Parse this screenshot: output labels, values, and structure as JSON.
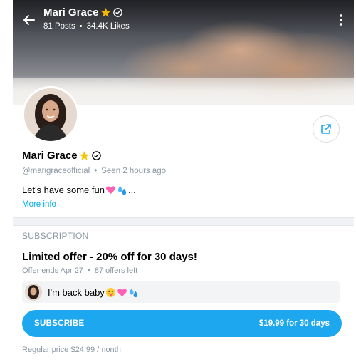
{
  "header": {
    "name": "Mari Grace",
    "posts": "81 Posts",
    "likes": "34.4K Likes",
    "separator": "•"
  },
  "profile": {
    "name": "Mari Grace",
    "handle": "@marigraceofficial",
    "separator": "•",
    "last_seen": "Seen 2 hours ago",
    "bio_text": "Let's have some fun",
    "bio_ellipsis": "...",
    "more_info": "More info"
  },
  "subscription": {
    "heading": "SUBSCRIPTION",
    "offer_title": "Limited offer - 20% off for 30 days!",
    "offer_ends": "Offer ends Apr 27",
    "separator": "•",
    "offers_left": "87 offers left",
    "message": "I'm back baby",
    "button_label": "SUBSCRIBE",
    "button_price": "$19.99 for 30 days",
    "regular_price": "Regular price $24.99 /month"
  },
  "colors": {
    "accent": "#1da7ee",
    "link": "#00aff0",
    "muted_text": "#8a96a3",
    "star": "#f5b800"
  },
  "icons": {
    "back": "arrow-left-icon",
    "more": "vertical-dots-icon",
    "verified": "verified-badge-icon",
    "star": "star-emoji-icon",
    "share": "share-icon",
    "heart": "pink-heart-emoji-icon",
    "droplets": "sweat-droplets-emoji-icon",
    "tongue": "tongue-face-emoji-icon"
  }
}
